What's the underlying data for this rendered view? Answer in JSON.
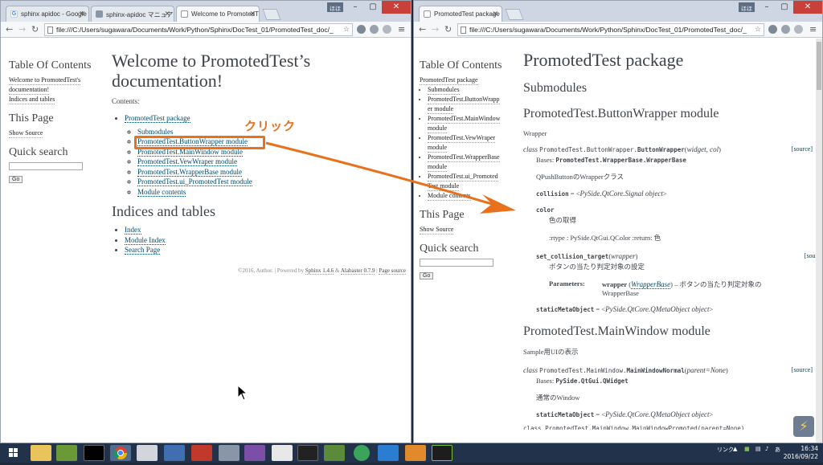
{
  "left_window": {
    "tabs": [
      {
        "label": "sphinx apidoc - Google",
        "icon": "google-icon"
      },
      {
        "label": "sphinx-apidoc マニュアル",
        "icon": "page-icon"
      },
      {
        "label": "Welcome to PromotedT",
        "icon": "document-icon",
        "active": true
      }
    ],
    "win_label": "ほほ",
    "address": "file:///C:/Users/sugawara/Documents/Work/Python/Sphinx/DocTest_01/PromotedTest_doc/_",
    "sidebar": {
      "toc_title": "Table Of Contents",
      "toc_items": [
        "Welcome to PromotedTest's",
        "documentation!",
        "Indices and tables"
      ],
      "this_page_title": "This Page",
      "show_source": "Show Source",
      "quick_search_title": "Quick search",
      "go_label": "Go"
    },
    "main": {
      "title": "Welcome to PromotedTest’s documentation!",
      "contents_label": "Contents:",
      "package_link": "PromotedTest package",
      "sub_links": [
        "Submodules",
        "PromotedTest.ButtonWrapper module",
        "PromotedTest.MainWindow module",
        "PromotedTest.VewWraper module",
        "PromotedTest.WrapperBase module",
        "PromotedTest.ui_PromotedTest module",
        "Module contents"
      ],
      "indices_title": "Indices and tables",
      "indices_links": [
        "Index",
        "Module Index",
        "Search Page"
      ],
      "footer": {
        "copy": "©2016, Author. | Powered by",
        "sphinx": "Sphinx 1.4.6",
        "amp": "&",
        "alabaster": "Alabaster 0.7.9",
        "sep": "|",
        "page_source": "Page source"
      }
    },
    "annotation": "クリック"
  },
  "right_window": {
    "tab": {
      "label": "PromotedTest package",
      "icon": "document-icon"
    },
    "win_label": "ほほ",
    "address": "file:///C:/Users/sugawara/Documents/Work/Python/Sphinx/DocTest_01/PromotedTest_doc/_",
    "sidebar": {
      "toc_title": "Table Of Contents",
      "package": "PromotedTest package",
      "items": [
        "Submodules",
        "PromotedTest.ButtonWrapp",
        "er module",
        "PromotedTest.MainWindow",
        "module",
        "PromotedTest.VewWraper",
        "module",
        "PromotedTest.WrapperBase",
        "module",
        "PromotedTest.ui_Promoted",
        "Test module",
        "Module contents"
      ],
      "this_page_title": "This Page",
      "show_source": "Show Source",
      "quick_search_title": "Quick search",
      "go_label": "Go"
    },
    "main": {
      "title": "PromotedTest package",
      "submodules": "Submodules",
      "bw_title": "PromotedTest.ButtonWrapper module",
      "bw_desc": "Wrapper",
      "cls_kw": "class",
      "bw_sig_prefix": "PromotedTest.ButtonWrapper.",
      "bw_sig_name": "ButtonWrapper",
      "bw_sig_params": "widget, col",
      "source": "[source]",
      "bases_label": "Bases:",
      "bw_bases": "PromotedTest.WrapperBase.WrapperBase",
      "bw_doc": "QPushButtonのWrapperクラス",
      "collision_name": "collision",
      "collision_val": "PySide.QtCore.Signal object",
      "color_name": "color",
      "color_doc": "色の取得",
      "color_rtype": ":rtype : PySide.QtGui.QColor :return: 色",
      "set_name": "set_collision_target",
      "set_param": "wrapper",
      "set_doc": "ボタンの当たり判定対象の設定",
      "params_label": "Parameters:",
      "param_name": "wrapper",
      "param_type": "WrapperBase",
      "param_doc_1": "– ボタンの当たり判定対象の",
      "param_doc_2": "WrapperBase",
      "meta_name": "staticMetaObject",
      "meta_val": "PySide.QtCore.QMetaObject object",
      "mw_title": "PromotedTest.MainWindow module",
      "mw_desc": "Sample用UIの表示",
      "mw_sig_prefix": "PromotedTest.MainWindow.",
      "mw_sig_name": "MainWindowNormal",
      "mw_sig_params": "parent=None",
      "mw_bases": "PySide.QtGui.QWidget",
      "mw_doc": "通常のWindow",
      "cut_sig": "class PromotedTest.MainWindow.MainWindowPromoted(parent=None)"
    }
  },
  "taskbar": {
    "tray_text": "リンク",
    "time": "16:34",
    "date": "2016/09/22"
  },
  "colors": {
    "accent": "#e8711e",
    "link": "#004b6b",
    "text": "#3e4349"
  }
}
